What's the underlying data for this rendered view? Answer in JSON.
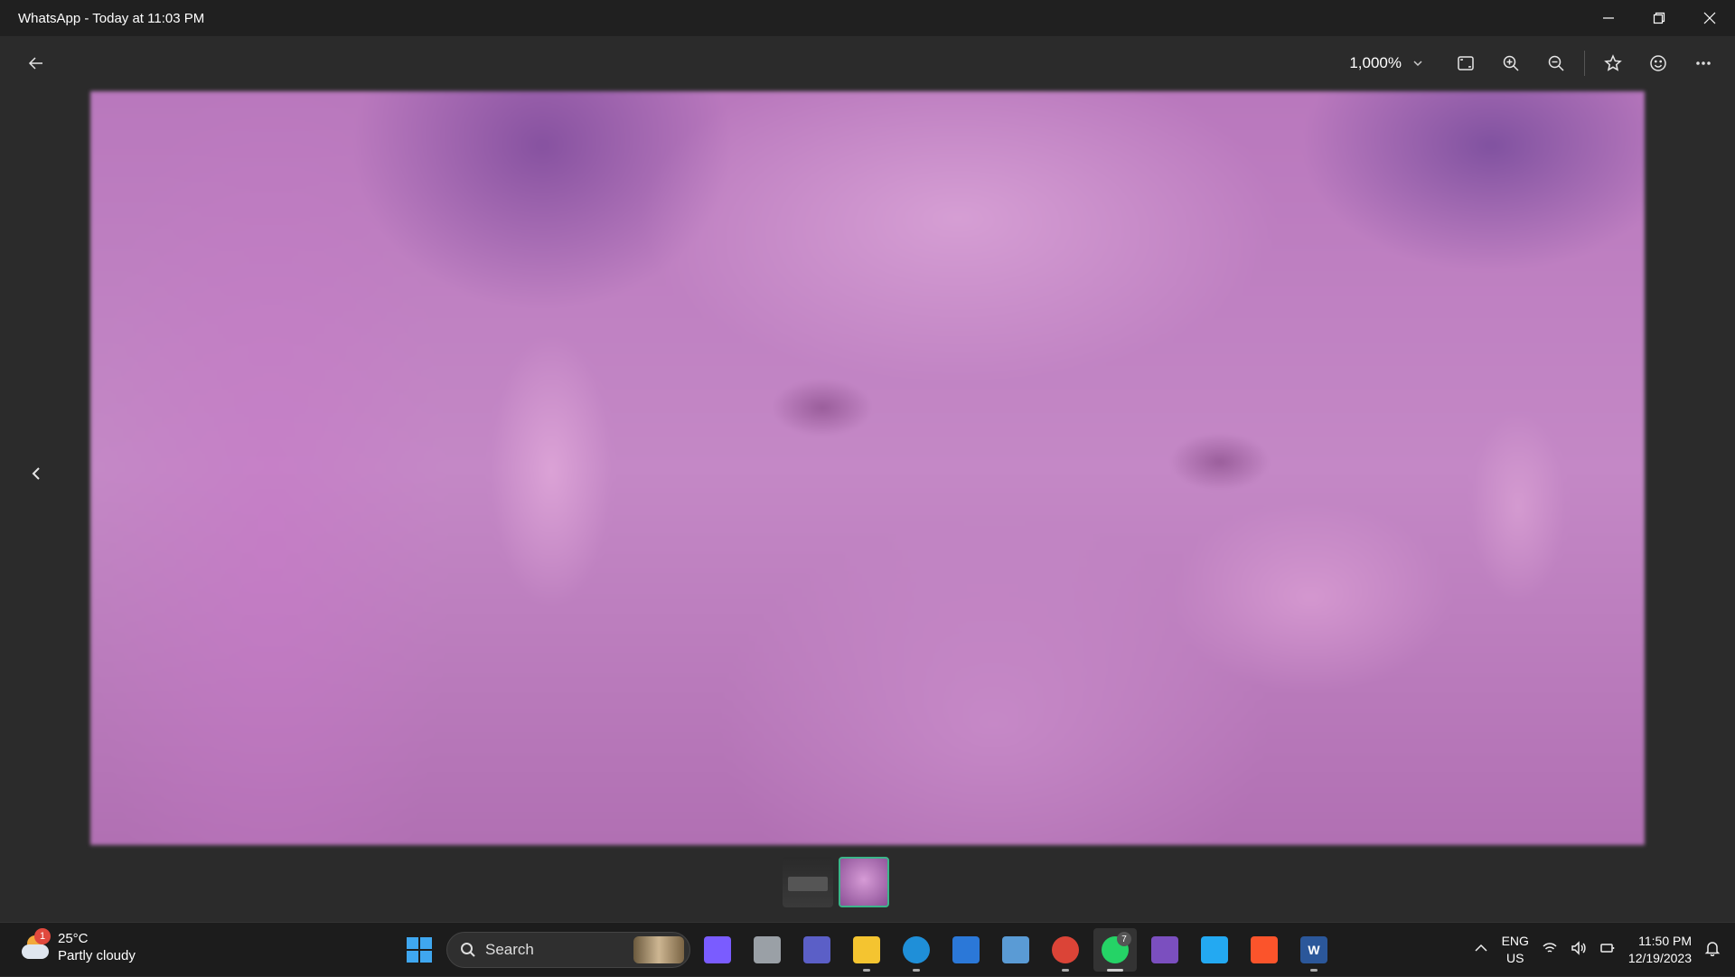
{
  "window": {
    "title": "WhatsApp - Today at 11:03 PM"
  },
  "toolbar": {
    "zoom_level": "1,000%"
  },
  "filmstrip": {
    "items": [
      "chat-screenshot",
      "photo"
    ],
    "selected_index": 1
  },
  "taskbar": {
    "weather": {
      "temp": "25°C",
      "condition": "Partly cloudy",
      "badge": "1"
    },
    "search_label": "Search",
    "apps": [
      {
        "name": "copilot",
        "color": "#7a5cff"
      },
      {
        "name": "task-view",
        "color": "#9aa0a6"
      },
      {
        "name": "teams",
        "color": "#5b5fc7"
      },
      {
        "name": "file-explorer",
        "color": "#f4c430"
      },
      {
        "name": "edge",
        "color": "#1f8fd8"
      },
      {
        "name": "microsoft-store",
        "color": "#2b78d8"
      },
      {
        "name": "photos",
        "color": "#5a9bd5"
      },
      {
        "name": "chrome",
        "color": "#db4437"
      },
      {
        "name": "whatsapp",
        "color": "#25d366",
        "badge": "7"
      },
      {
        "name": "visual-studio",
        "color": "#7b4fbf"
      },
      {
        "name": "vscode",
        "color": "#23a9f2"
      },
      {
        "name": "brave",
        "color": "#fb542b"
      },
      {
        "name": "word",
        "color": "#2b579a",
        "letter": "W"
      }
    ],
    "language": {
      "line1": "ENG",
      "line2": "US"
    },
    "clock": {
      "time": "11:50 PM",
      "date": "12/19/2023"
    }
  }
}
